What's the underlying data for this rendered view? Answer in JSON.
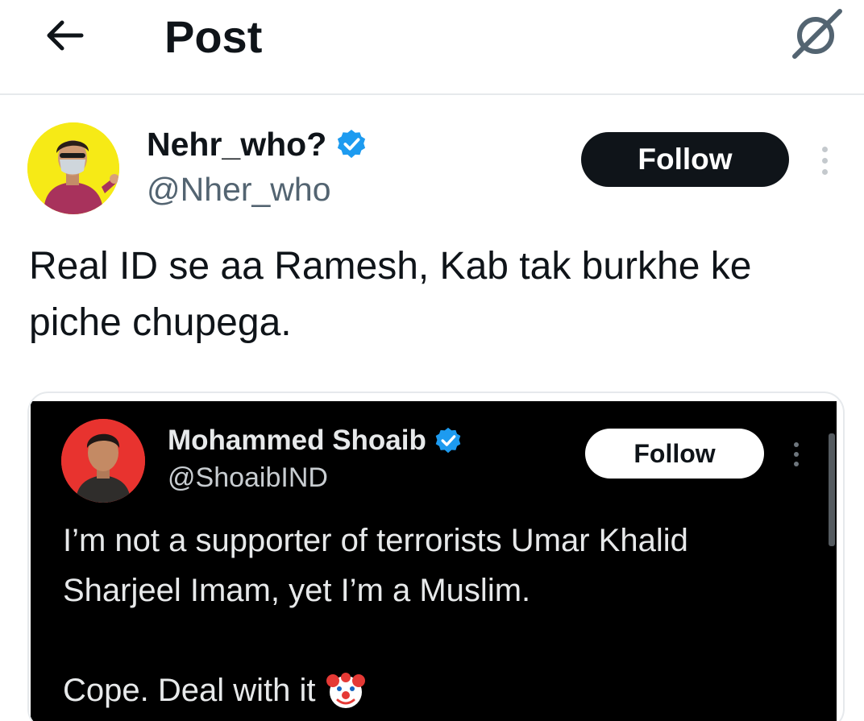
{
  "header": {
    "title": "Post",
    "back_icon": "arrow-left-icon",
    "grok_icon": "grok-icon"
  },
  "author": {
    "display_name": "Nehr_who?",
    "handle": "@Nher_who",
    "verified": true,
    "follow_label": "Follow",
    "more_icon": "more-vertical-icon"
  },
  "post": {
    "text": "Real ID se aa Ramesh, Kab tak burkhe ke piche chupega."
  },
  "quoted_screenshot": {
    "display_name": "Mohammed Shoaib",
    "handle": "@ShoaibIND",
    "verified": true,
    "follow_label": "Follow",
    "text": "I’m not a supporter of terrorists Umar Khalid\nSharjeel Imam, yet I’m a Muslim.",
    "closing_text": "Cope. Deal with it",
    "emoji_icon": "clown-face-icon"
  },
  "colors": {
    "verified_blue": "#1d9bf0",
    "follow_dark": "#0f1419",
    "avatar_yellow": "#f6ea16",
    "avatar_red": "#e8332f"
  }
}
